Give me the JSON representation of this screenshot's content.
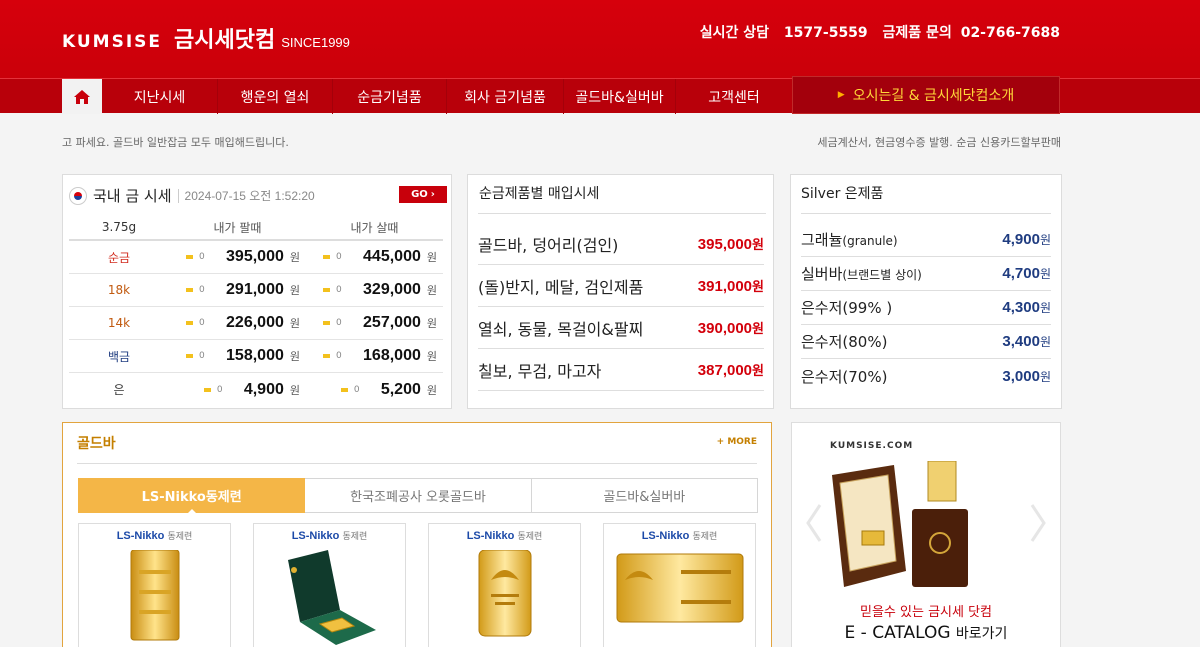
{
  "header": {
    "logo_en": "KUMSISE",
    "logo_ko": "금시세닷컴",
    "since": "SINCE1999",
    "contact_label": "실시간 상담",
    "contact_phone": "1577-5559",
    "inquiry_label": "금제품 문의",
    "inquiry_phone": "02-766-7688"
  },
  "nav": {
    "items": [
      {
        "label": "지난시세"
      },
      {
        "label": "행운의 열쇠"
      },
      {
        "label": "순금기념품"
      },
      {
        "label": "회사 금기념품"
      },
      {
        "label": "골드바&실버바"
      },
      {
        "label": "고객센터"
      }
    ],
    "special": "오시는길 & 금시세닷컴소개"
  },
  "notice": {
    "left": "고 파세요. 골드바 일반잡금 모두 매입해드립니다.",
    "right": "세금계산서, 현금영수증 발행. 순금 신용카드할부판매"
  },
  "gold_price": {
    "title": "국내 금 시세",
    "datetime": "2024-07-15 오전 1:52:20",
    "go": "GO",
    "unit": "3.75g",
    "col_sell": "내가 팔때",
    "col_buy": "내가 살때",
    "won": "원",
    "rows": [
      {
        "name": "순금",
        "sell_chg": "0",
        "sell": "395,000",
        "buy_chg": "0",
        "buy": "445,000"
      },
      {
        "name": "18k",
        "sell_chg": "0",
        "sell": "291,000",
        "buy_chg": "0",
        "buy": "329,000"
      },
      {
        "name": "14k",
        "sell_chg": "0",
        "sell": "226,000",
        "buy_chg": "0",
        "buy": "257,000"
      },
      {
        "name": "백금",
        "sell_chg": "0",
        "sell": "158,000",
        "buy_chg": "0",
        "buy": "168,000"
      },
      {
        "name": "은",
        "sell_chg": "0",
        "sell": "4,900",
        "buy_chg": "0",
        "buy": "5,200"
      }
    ]
  },
  "pure_gold": {
    "title": "순금제품별 매입시세",
    "won": "원",
    "rows": [
      {
        "name": "골드바, 덩어리(검인)",
        "price": "395,000"
      },
      {
        "name": "(돌)반지, 메달, 검인제품",
        "price": "391,000"
      },
      {
        "name": "열쇠, 동물, 목걸이&팔찌",
        "price": "390,000"
      },
      {
        "name": "칠보, 무검, 마고자",
        "price": "387,000"
      }
    ]
  },
  "silver": {
    "title": "Silver 은제품",
    "won": "원",
    "rows": [
      {
        "name": "그래뉼",
        "note": "(granule)",
        "price": "4,900"
      },
      {
        "name": "실버바",
        "note": "(브랜드별 상이)",
        "price": "4,700"
      },
      {
        "name": "은수저(99% )",
        "note": "",
        "price": "4,300"
      },
      {
        "name": "은수저(80%)",
        "note": "",
        "price": "3,400"
      },
      {
        "name": "은수저(70%)",
        "note": "",
        "price": "3,000"
      }
    ]
  },
  "goldbar": {
    "title": "골드바",
    "more": "+ MORE",
    "tabs": [
      {
        "label": "LS-Nikko동제련"
      },
      {
        "label": "한국조폐공사 오롯골드바"
      },
      {
        "label": "골드바&실버바"
      }
    ],
    "products": [
      {
        "brand": "LS-Nikko",
        "brand_sub": "동제련"
      },
      {
        "brand": "LS-Nikko",
        "brand_sub": "동제련"
      },
      {
        "brand": "LS-Nikko",
        "brand_sub": "동제련"
      },
      {
        "brand": "LS-Nikko",
        "brand_sub": "동제련"
      }
    ]
  },
  "catalog": {
    "brand": "KUMSISE.COM",
    "line1": "믿을수 있는 금시세 닷컴",
    "line2_main": "E - CATALOG",
    "line2_sub": "바로가기"
  },
  "colors": {
    "brand_red": "#c8000b",
    "nav_dark": "#b8000a",
    "gold_tab": "#f4b647",
    "price_red": "#d3000b",
    "price_navy": "#1f3c80"
  }
}
